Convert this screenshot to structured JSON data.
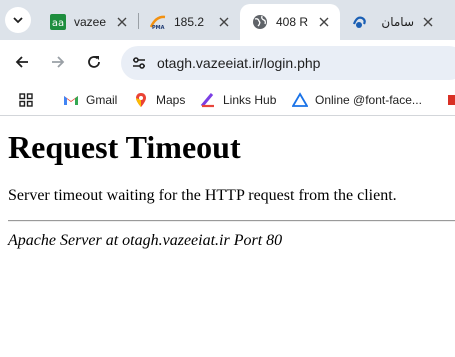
{
  "browser": {
    "tabs": [
      {
        "title": "vazee",
        "favicon": "aa-site-icon",
        "active": false
      },
      {
        "title": "185.2",
        "favicon": "phpmyadmin-icon",
        "active": false
      },
      {
        "title": "408 R",
        "favicon": "globe-icon",
        "active": true
      },
      {
        "title": "سامان",
        "favicon": "saman-site-icon",
        "active": false
      }
    ],
    "url": "otagh.vazeeiat.ir/login.php",
    "bookmarks": [
      {
        "label": "Gmail",
        "icon": "gmail-icon"
      },
      {
        "label": "Maps",
        "icon": "maps-icon"
      },
      {
        "label": "Links Hub",
        "icon": "links-hub-icon"
      },
      {
        "label": "Online @font-face...",
        "icon": "font-face-icon"
      }
    ]
  },
  "page": {
    "heading": "Request Timeout",
    "message": "Server timeout waiting for the HTTP request from the client.",
    "footer": "Apache Server at otagh.vazeeiat.ir Port 80"
  },
  "colors": {
    "tabstrip": "#dde3ea",
    "omnibox": "#e9eef6",
    "accent_blue": "#1a73e8"
  }
}
